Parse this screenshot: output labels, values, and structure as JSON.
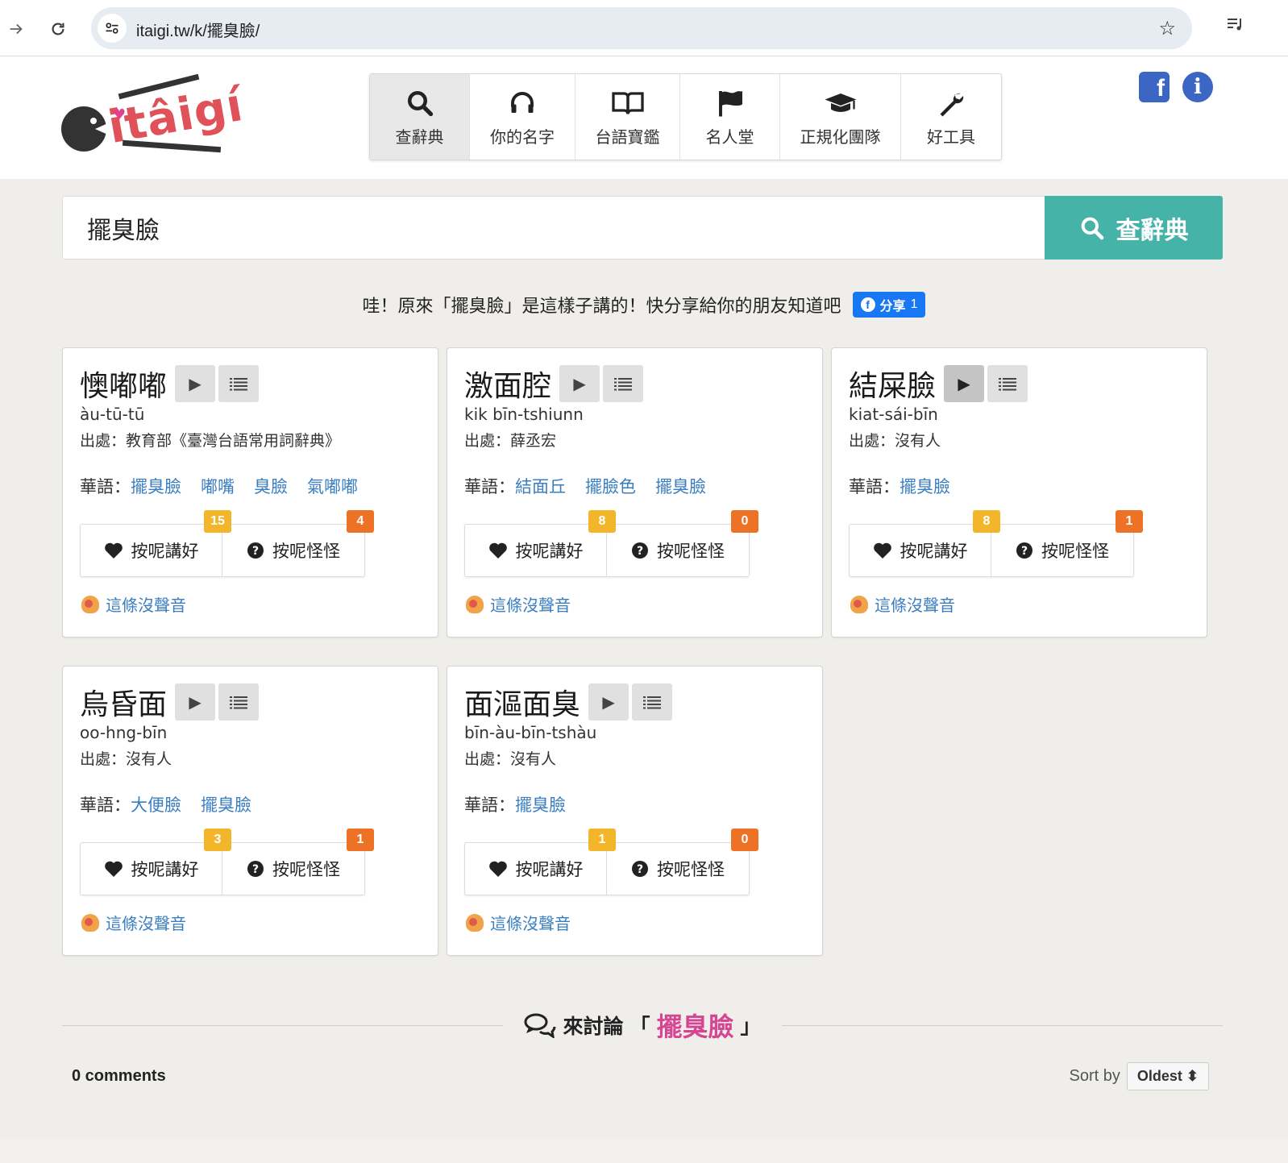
{
  "browser": {
    "url": "itaigi.tw/k/擺臭臉/"
  },
  "nav": [
    {
      "label": "查辭典",
      "icon": "search-icon"
    },
    {
      "label": "你的名字",
      "icon": "headphones-icon"
    },
    {
      "label": "台語寶鑑",
      "icon": "book-icon"
    },
    {
      "label": "名人堂",
      "icon": "flag-icon"
    },
    {
      "label": "正規化團隊",
      "icon": "graduation-cap-icon"
    },
    {
      "label": "好工具",
      "icon": "wrench-icon"
    }
  ],
  "logo": {
    "text": "itâigí"
  },
  "search": {
    "value": "擺臭臉",
    "button_label": "查辭典"
  },
  "share": {
    "text": "哇！原來「擺臭臉」是這樣子講的！快分享給你的朋友知道吧",
    "button_label": "分享",
    "count": "1"
  },
  "labels": {
    "source_prefix": "出處：",
    "huagi_prefix": "華語：",
    "like": "按呢講好",
    "weird": "按呢怪怪",
    "no_sound": "這條沒聲音"
  },
  "cards": [
    {
      "hanji": "懊嘟嘟",
      "roman": "àu-tū-tū",
      "source": "教育部《臺灣台語常用詞辭典》",
      "huagi": [
        "擺臭臉",
        "嘟嘴",
        "臭臉",
        "氣嘟嘟"
      ],
      "likes": "15",
      "weird": "4"
    },
    {
      "hanji": "激面腔",
      "roman": "kik bīn-tshiunn",
      "source": "薛丞宏",
      "huagi": [
        "結面丘",
        "擺臉色",
        "擺臭臉"
      ],
      "likes": "8",
      "weird": "0"
    },
    {
      "hanji": "結屎臉",
      "roman": "kiat-sái-bīn",
      "source": "沒有人",
      "huagi": [
        "擺臭臉"
      ],
      "likes": "8",
      "weird": "1"
    },
    {
      "hanji": "烏昏面",
      "roman": "oo-hng-bīn",
      "source": "沒有人",
      "huagi": [
        "大便臉",
        "擺臭臉"
      ],
      "likes": "3",
      "weird": "1"
    },
    {
      "hanji": "面漚面臭",
      "roman": "bīn-àu-bīn-tshàu",
      "source": "沒有人",
      "huagi": [
        "擺臭臉"
      ],
      "likes": "1",
      "weird": "0"
    }
  ],
  "discuss": {
    "prefix": "來討論",
    "open_quote": "「",
    "keyword": "擺臭臉",
    "close_quote": "」"
  },
  "comments": {
    "count_label": "0 comments",
    "sort_label": "Sort by",
    "sort_value": "Oldest"
  },
  "colors": {
    "accent_teal": "#46b3a9",
    "link_blue": "#3a7ec0",
    "badge_yellow": "#f3b52a",
    "badge_orange": "#ed7226",
    "keyword_pink": "#d64591"
  }
}
